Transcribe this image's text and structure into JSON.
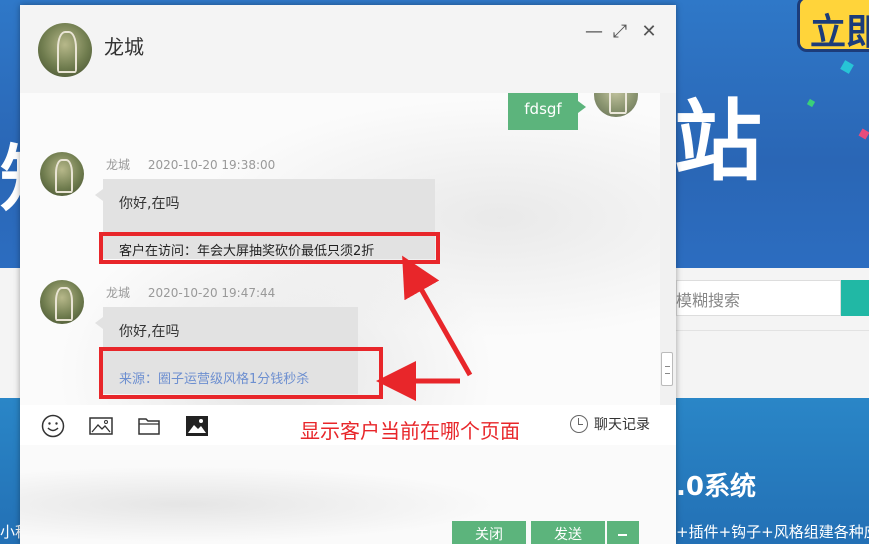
{
  "background": {
    "big_char": "站",
    "left_char": "知",
    "badge_text": "立即",
    "search_placeholder": "模糊搜索",
    "section_title": ".0系统",
    "section_desc": "+插件+钩子+风格组建各种应用",
    "left_bottom_text": "小程"
  },
  "header": {
    "contact_name": "龙城",
    "min_icon": "—",
    "max_icon": "⤢",
    "close_icon": "✕"
  },
  "messages": {
    "outgoing_text": "fdsgf",
    "m1": {
      "sender": "龙城",
      "time": "2020-10-20 19:38:00",
      "text": "你好,在吗",
      "visiting": "客户在访问：年会大屏抽奖砍价最低只须2折"
    },
    "m2": {
      "sender": "龙城",
      "time": "2020-10-20 19:47:44",
      "text": "你好,在吗",
      "source": "来源：圈子运营级风格1分钱秒杀"
    }
  },
  "annotation": "显示客户当前在哪个页面",
  "toolbar": {
    "history_label": "聊天记录",
    "icons": [
      "smile-icon",
      "image-icon",
      "folder-icon",
      "picture-icon"
    ]
  },
  "buttons": {
    "close_label": "关闭",
    "send_label": "发送"
  },
  "colors": {
    "accent_green": "#5cb47c",
    "highlight_red": "#e8262a",
    "link_blue": "#6d8fd0"
  }
}
